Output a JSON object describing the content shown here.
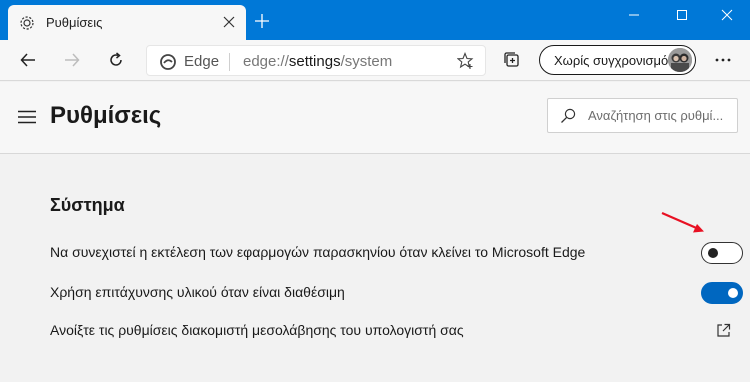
{
  "tab": {
    "title": "Ρυθμίσεις",
    "icon": "gear-icon"
  },
  "window": {
    "minimize_icon": "minimize-icon",
    "maximize_icon": "maximize-icon",
    "close_icon": "close-icon"
  },
  "toolbar": {
    "back_icon": "back-arrow-icon",
    "forward_icon": "forward-arrow-icon",
    "refresh_icon": "refresh-icon",
    "address": {
      "brand": "Edge",
      "url_scheme": "edge://",
      "url_host": "settings",
      "url_path": "/system"
    },
    "favorites_icon": "star-icon",
    "collections_icon": "collections-icon",
    "profile_label": "Χωρίς συγχρονισμό",
    "more_icon": "more-icon"
  },
  "settings": {
    "title": "Ρυθμίσεις",
    "search_placeholder": "Αναζήτηση στις ρυθμί...",
    "section_title": "Σύστημα",
    "rows": [
      {
        "label": "Να συνεχιστεί η εκτέλεση των εφαρμογών παρασκηνίου όταν κλείνει το Microsoft Edge",
        "control": "toggle",
        "state": "off"
      },
      {
        "label": "Χρήση επιτάχυνσης υλικού όταν είναι διαθέσιμη",
        "control": "toggle",
        "state": "on"
      },
      {
        "label": "Ανοίξτε τις ρυθμίσεις διακομιστή μεσολάβησης του υπολογιστή σας",
        "control": "external-link"
      }
    ]
  },
  "colors": {
    "titlebar": "#0078d7",
    "toggle_on": "#0067c0",
    "annotation_arrow": "#e81123"
  }
}
